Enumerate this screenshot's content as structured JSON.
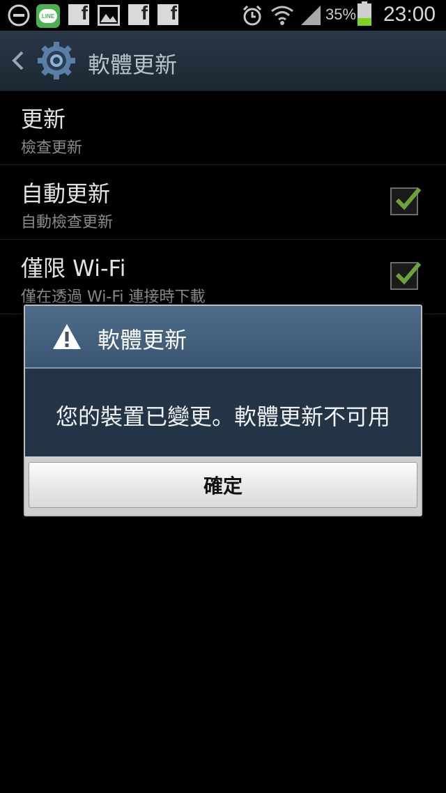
{
  "status_bar": {
    "line_badge": "LINE",
    "battery_percent": "35%",
    "time": "23:00",
    "icons": [
      "minus-circle-icon",
      "line-app-icon",
      "facebook-icon",
      "gallery-icon",
      "facebook-icon",
      "facebook-icon",
      "alarm-icon",
      "wifi-icon",
      "signal-icon",
      "battery-icon"
    ]
  },
  "action_bar": {
    "title": "軟體更新",
    "icons": [
      "back-icon",
      "settings-gear-icon"
    ]
  },
  "settings": [
    {
      "title": "更新",
      "subtitle": "檢查更新",
      "checkbox": null
    },
    {
      "title": "自動更新",
      "subtitle": "自動檢查更新",
      "checkbox": true
    },
    {
      "title": "僅限 Wi-Fi",
      "subtitle": "僅在透過 Wi-Fi 連接時下載",
      "checkbox": true
    }
  ],
  "dialog": {
    "title": "軟體更新",
    "message": "您的裝置已變更。軟體更新不可用",
    "ok_label": "確定",
    "icon": "warning-icon"
  },
  "colors": {
    "accent_check": "#6aa33a",
    "action_bar": "#243140",
    "dialog_header": "#456381",
    "dialog_body": "#223446"
  }
}
